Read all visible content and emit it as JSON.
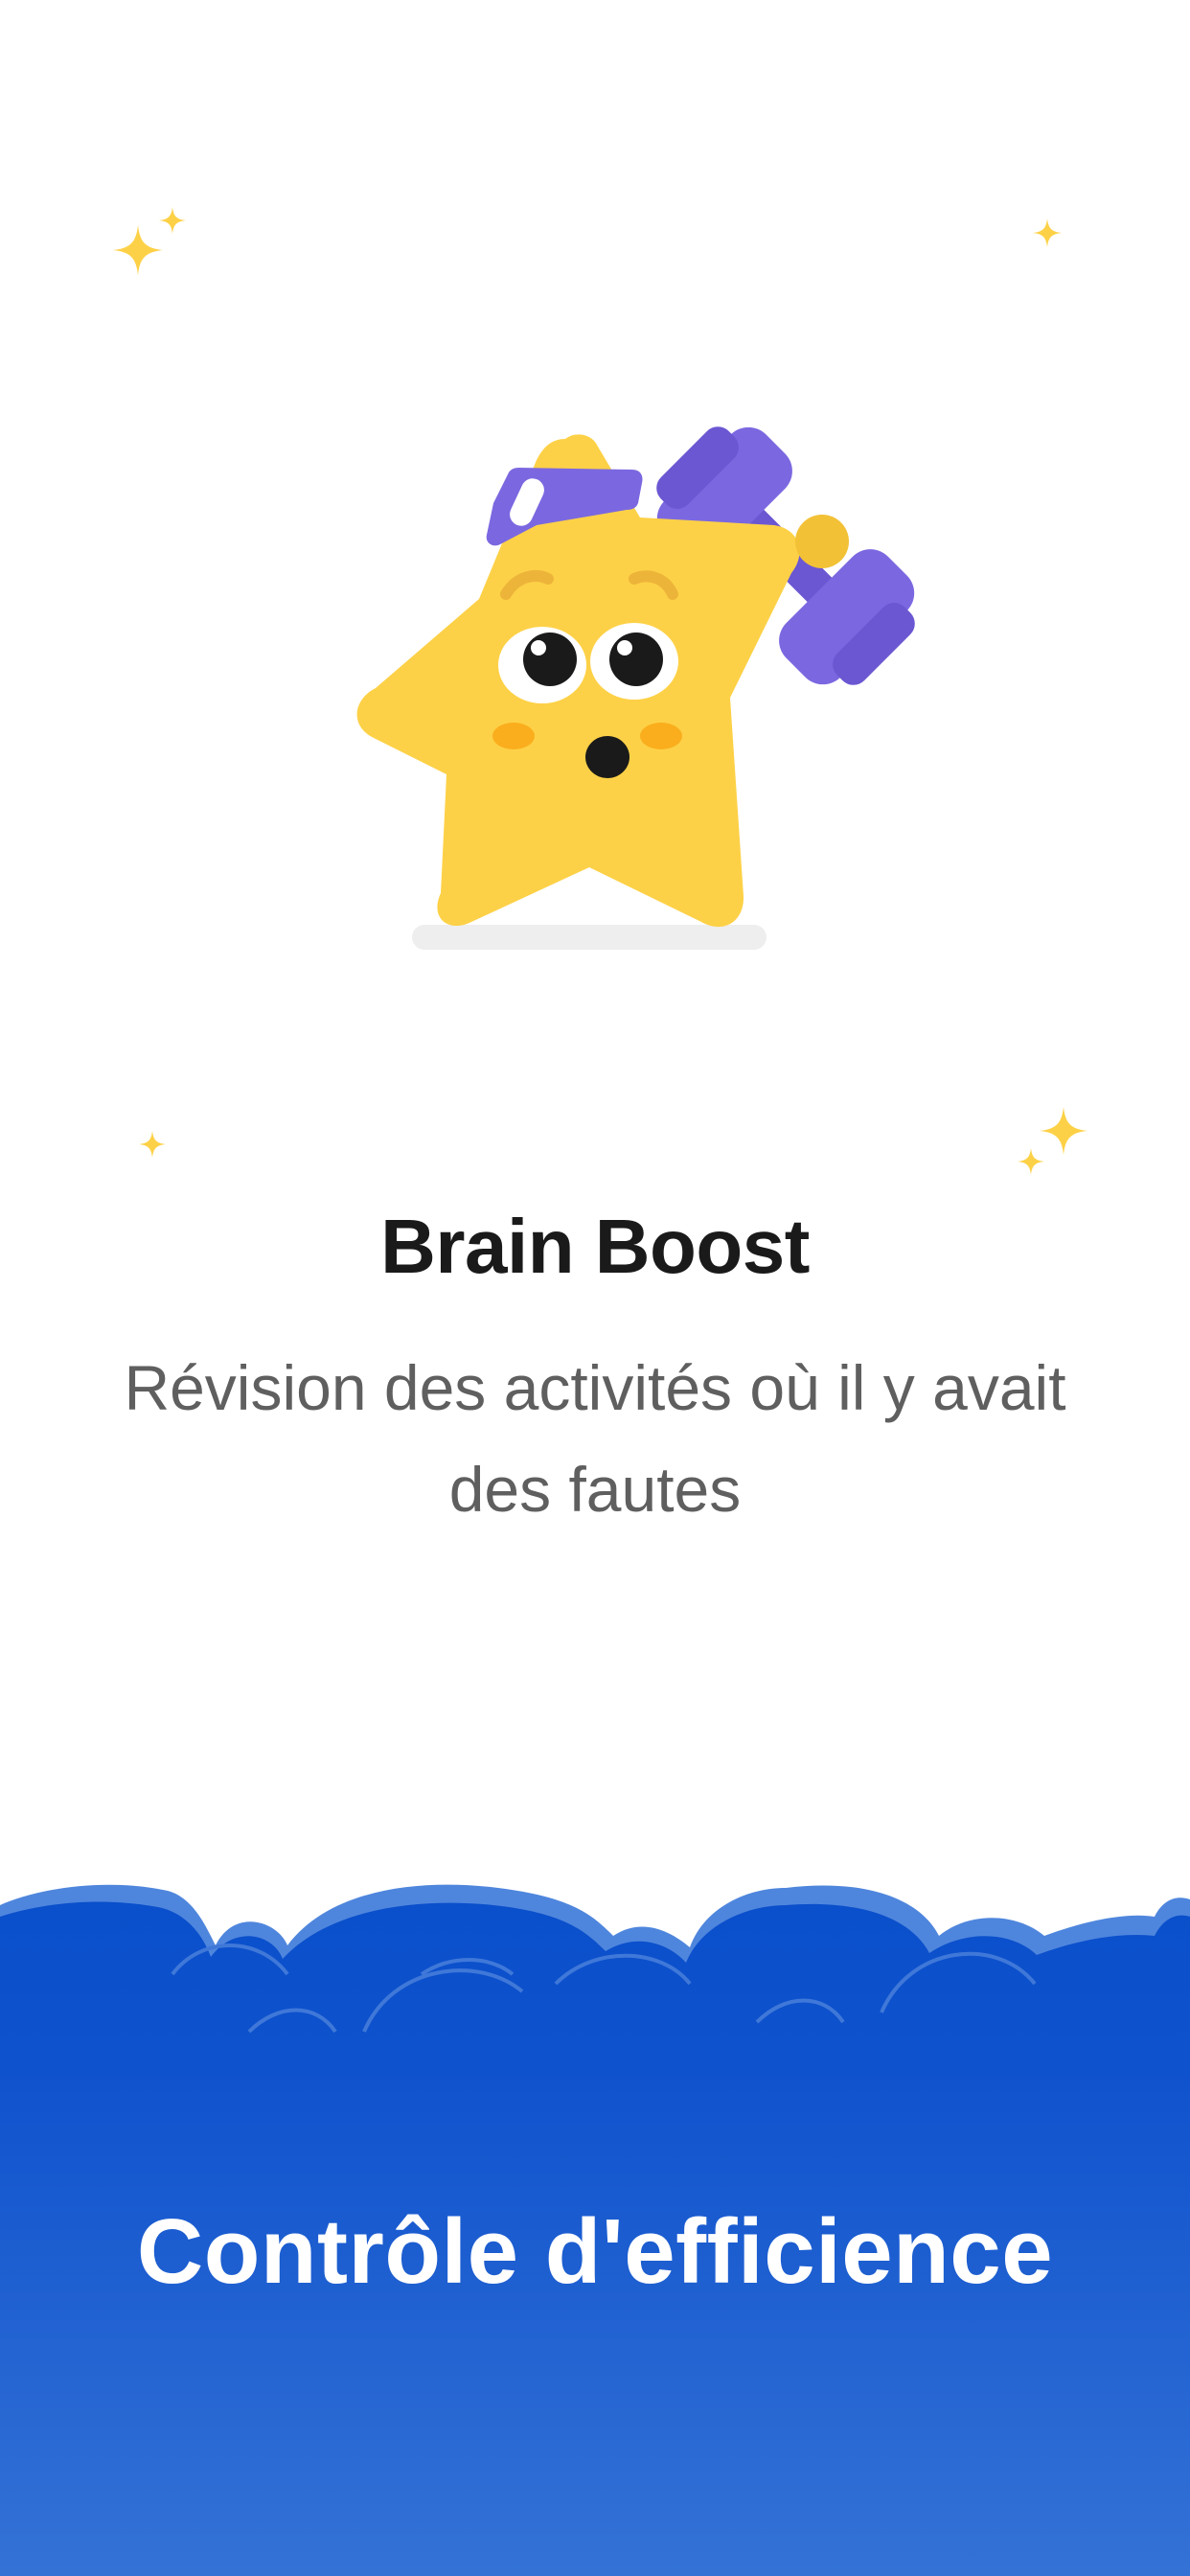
{
  "screen": {
    "title": "Brain Boost",
    "subtitle": "Révision des activités où il y avait des fautes",
    "footer_title": "Contrôle d'efficience"
  },
  "illustration": {
    "icon": "star-mascot-lifting-dumbbell-icon"
  },
  "colors": {
    "background": "#ffffff",
    "star": "#FDD147",
    "accent_purple": "#7B68E0",
    "footer_blue_top": "#0A4FCB",
    "footer_blue_bottom": "#3472D6",
    "title_text": "#1a1a1a",
    "subtitle_text": "#5f5f5f"
  }
}
